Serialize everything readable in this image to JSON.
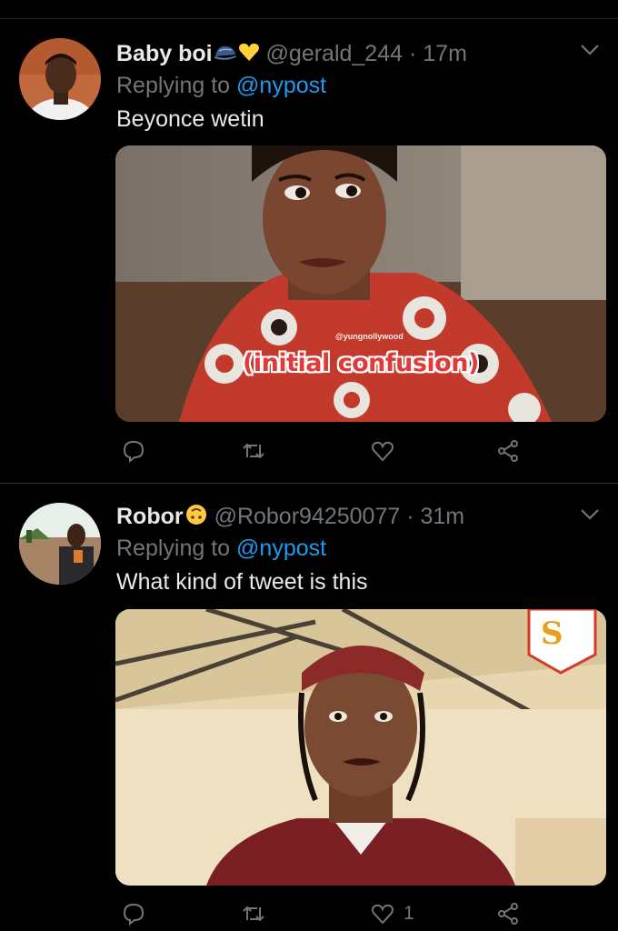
{
  "tweets": [
    {
      "name": "Baby boi",
      "name_emojis": [
        "cap-emoji",
        "yellow-heart-emoji"
      ],
      "handle": "@gerald_244",
      "separator": "·",
      "time": "17m",
      "replying_prefix": "Replying to",
      "replying_to": "@nypost",
      "text": "Beyonce wetin",
      "media": {
        "watermark": "@yungnollywood",
        "caption": "(initial confusion)"
      },
      "actions": {
        "reply_icon": "reply-icon",
        "retweet_icon": "retweet-icon",
        "like_icon": "like-icon",
        "share_icon": "share-icon",
        "like_count": ""
      }
    },
    {
      "name": "Robor",
      "name_emojis": [
        "upside-down-face-emoji"
      ],
      "handle": "@Robor94250077",
      "separator": "·",
      "time": "31m",
      "replying_prefix": "Replying to",
      "replying_to": "@nypost",
      "text": "What kind of tweet is this",
      "media": {
        "logo_letter": "S"
      },
      "actions": {
        "reply_icon": "reply-icon",
        "retweet_icon": "retweet-icon",
        "like_icon": "like-icon",
        "share_icon": "share-icon",
        "like_count": "1"
      }
    }
  ],
  "colors": {
    "background": "#000000",
    "text": "#e7e9ea",
    "muted": "#71767b",
    "link": "#1d9bf0",
    "divider": "#2f3336"
  }
}
